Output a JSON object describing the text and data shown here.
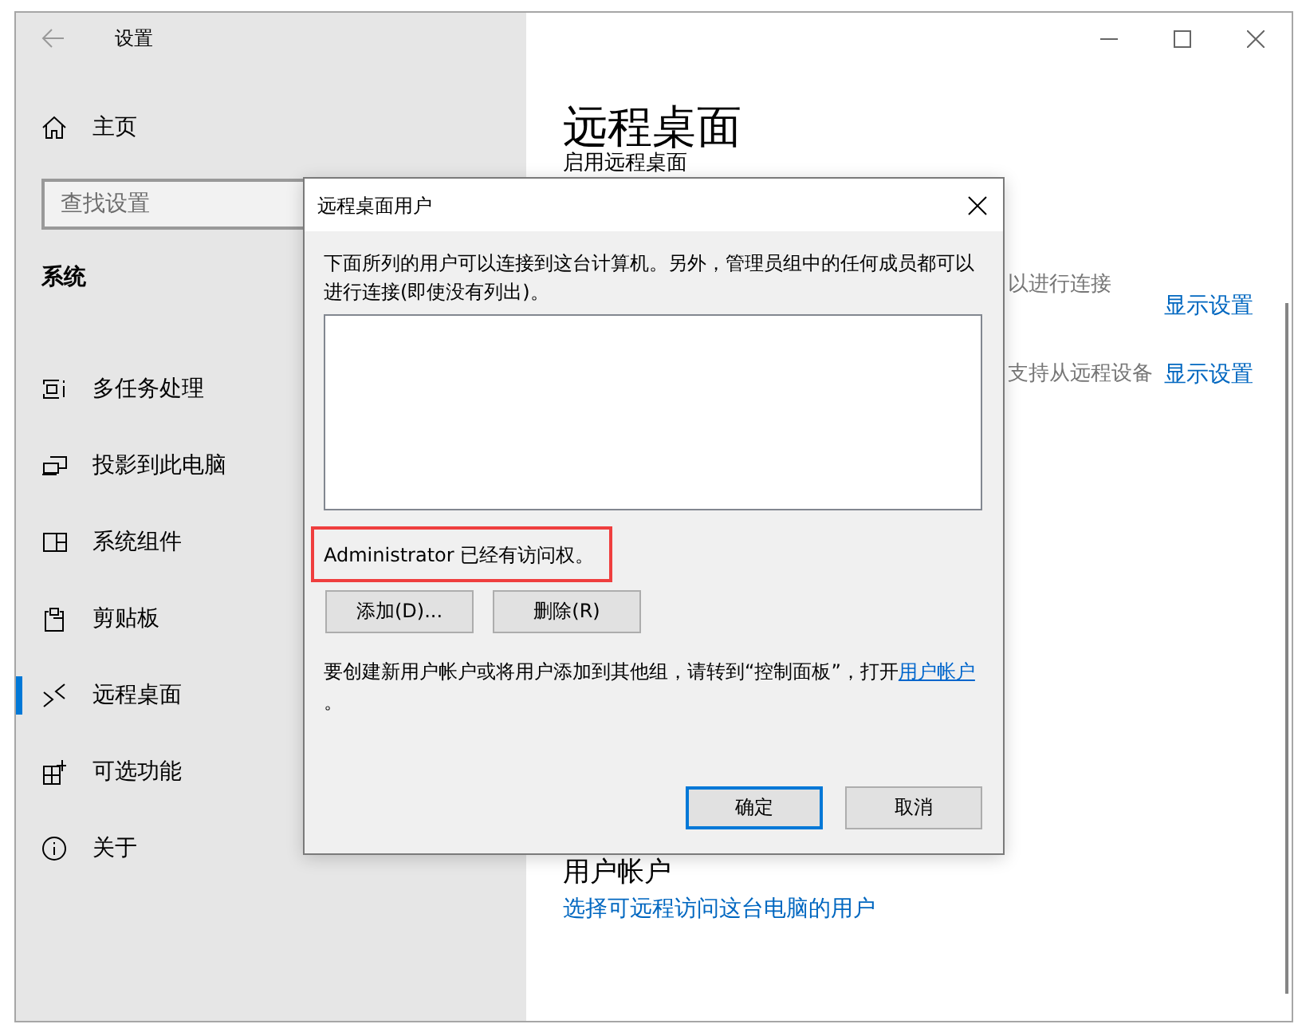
{
  "window": {
    "title": "设置"
  },
  "sidebar": {
    "home": "主页",
    "search": {
      "placeholder": "查找设置"
    },
    "section": "系统",
    "items": [
      {
        "label": "多任务处理",
        "selected": false
      },
      {
        "label": "投影到此电脑",
        "selected": false
      },
      {
        "label": "系统组件",
        "selected": false
      },
      {
        "label": "剪贴板",
        "selected": false
      },
      {
        "label": "远程桌面",
        "selected": true
      },
      {
        "label": "可选功能",
        "selected": false
      },
      {
        "label": "关于",
        "selected": false
      }
    ]
  },
  "page": {
    "title": "远程桌面",
    "subtitle": "启用远程桌面",
    "settings": [
      {
        "text": "以进行连接",
        "link": "显示设置"
      },
      {
        "text": "支持从远程设备",
        "link": "显示设置"
      }
    ],
    "section_title": "用户帐户",
    "link": "选择可远程访问这台电脑的用户"
  },
  "dialog": {
    "title": "远程桌面用户",
    "description": "下面所列的用户可以连接到这台计算机。另外，管理员组中的任何成员都可以进行连接(即使没有列出)。",
    "status": {
      "text": "Administrator 已经有访问权。",
      "highlighted": true
    },
    "buttons": [
      {
        "label": "添加(D)..."
      },
      {
        "label": "删除(R)"
      }
    ],
    "note": {
      "text": "要创建新用户帐户或将用户添加到其他组，请转到“控制面板”，打开",
      "link": "用户帐户",
      "after": "。"
    },
    "footer_buttons": [
      {
        "label": "确定",
        "default": true
      },
      {
        "label": "取消",
        "default": false
      }
    ]
  }
}
